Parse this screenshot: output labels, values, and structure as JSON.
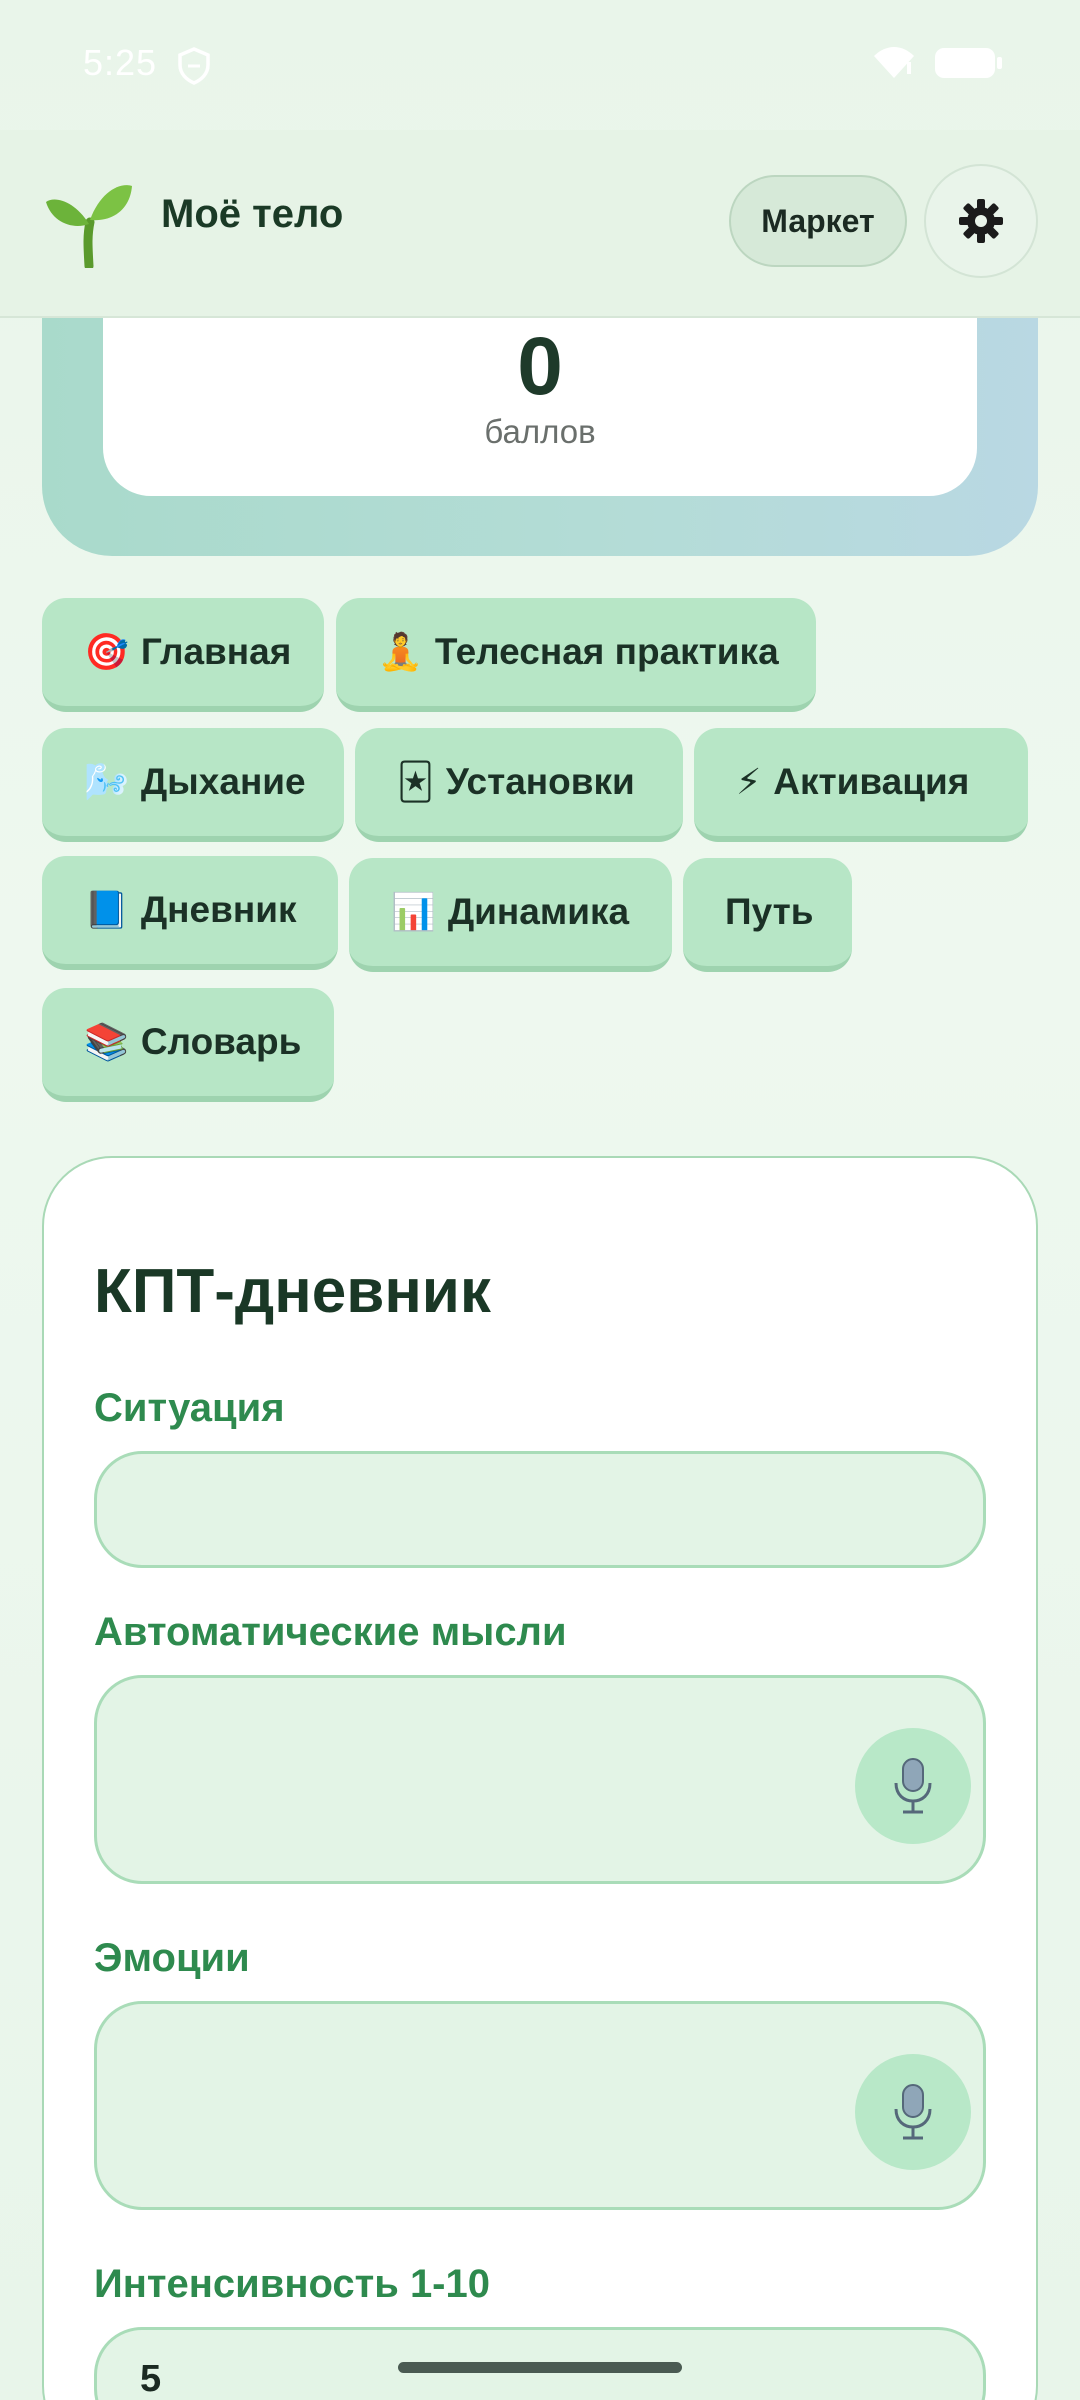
{
  "status_bar": {
    "time": "5:25"
  },
  "header": {
    "app_title": "Моё тело",
    "market_label": "Маркет"
  },
  "score": {
    "value": "0",
    "label": "баллов"
  },
  "tabs": [
    {
      "emoji": "🎯",
      "label": "Главная"
    },
    {
      "emoji": "🧘",
      "label": "Телесная практика"
    },
    {
      "emoji": "🌬️",
      "label": "Дыхание"
    },
    {
      "emoji": "🃏",
      "label": "Установки"
    },
    {
      "emoji": "⚡",
      "label": "Активация"
    },
    {
      "emoji": "📘",
      "label": "Дневник"
    },
    {
      "emoji": "📊",
      "label": "Динамика"
    },
    {
      "emoji": "",
      "label": "Путь"
    },
    {
      "emoji": "📚",
      "label": "Словарь"
    }
  ],
  "diary": {
    "title": "КПТ-дневник",
    "situation_label": "Ситуация",
    "situation_value": "",
    "thoughts_label": "Автоматические мысли",
    "thoughts_value": "",
    "emotions_label": "Эмоции",
    "emotions_value": "",
    "intensity_label": "Интенсивность 1-10",
    "intensity_value": "5"
  },
  "icons": {
    "logo": "sprout-icon",
    "settings": "gear-icon",
    "mic": "microphone-icon"
  },
  "colors": {
    "accent_green": "#2e8a4e",
    "tab_bg": "#b7e6c6",
    "field_bg": "#e3f4e6"
  }
}
